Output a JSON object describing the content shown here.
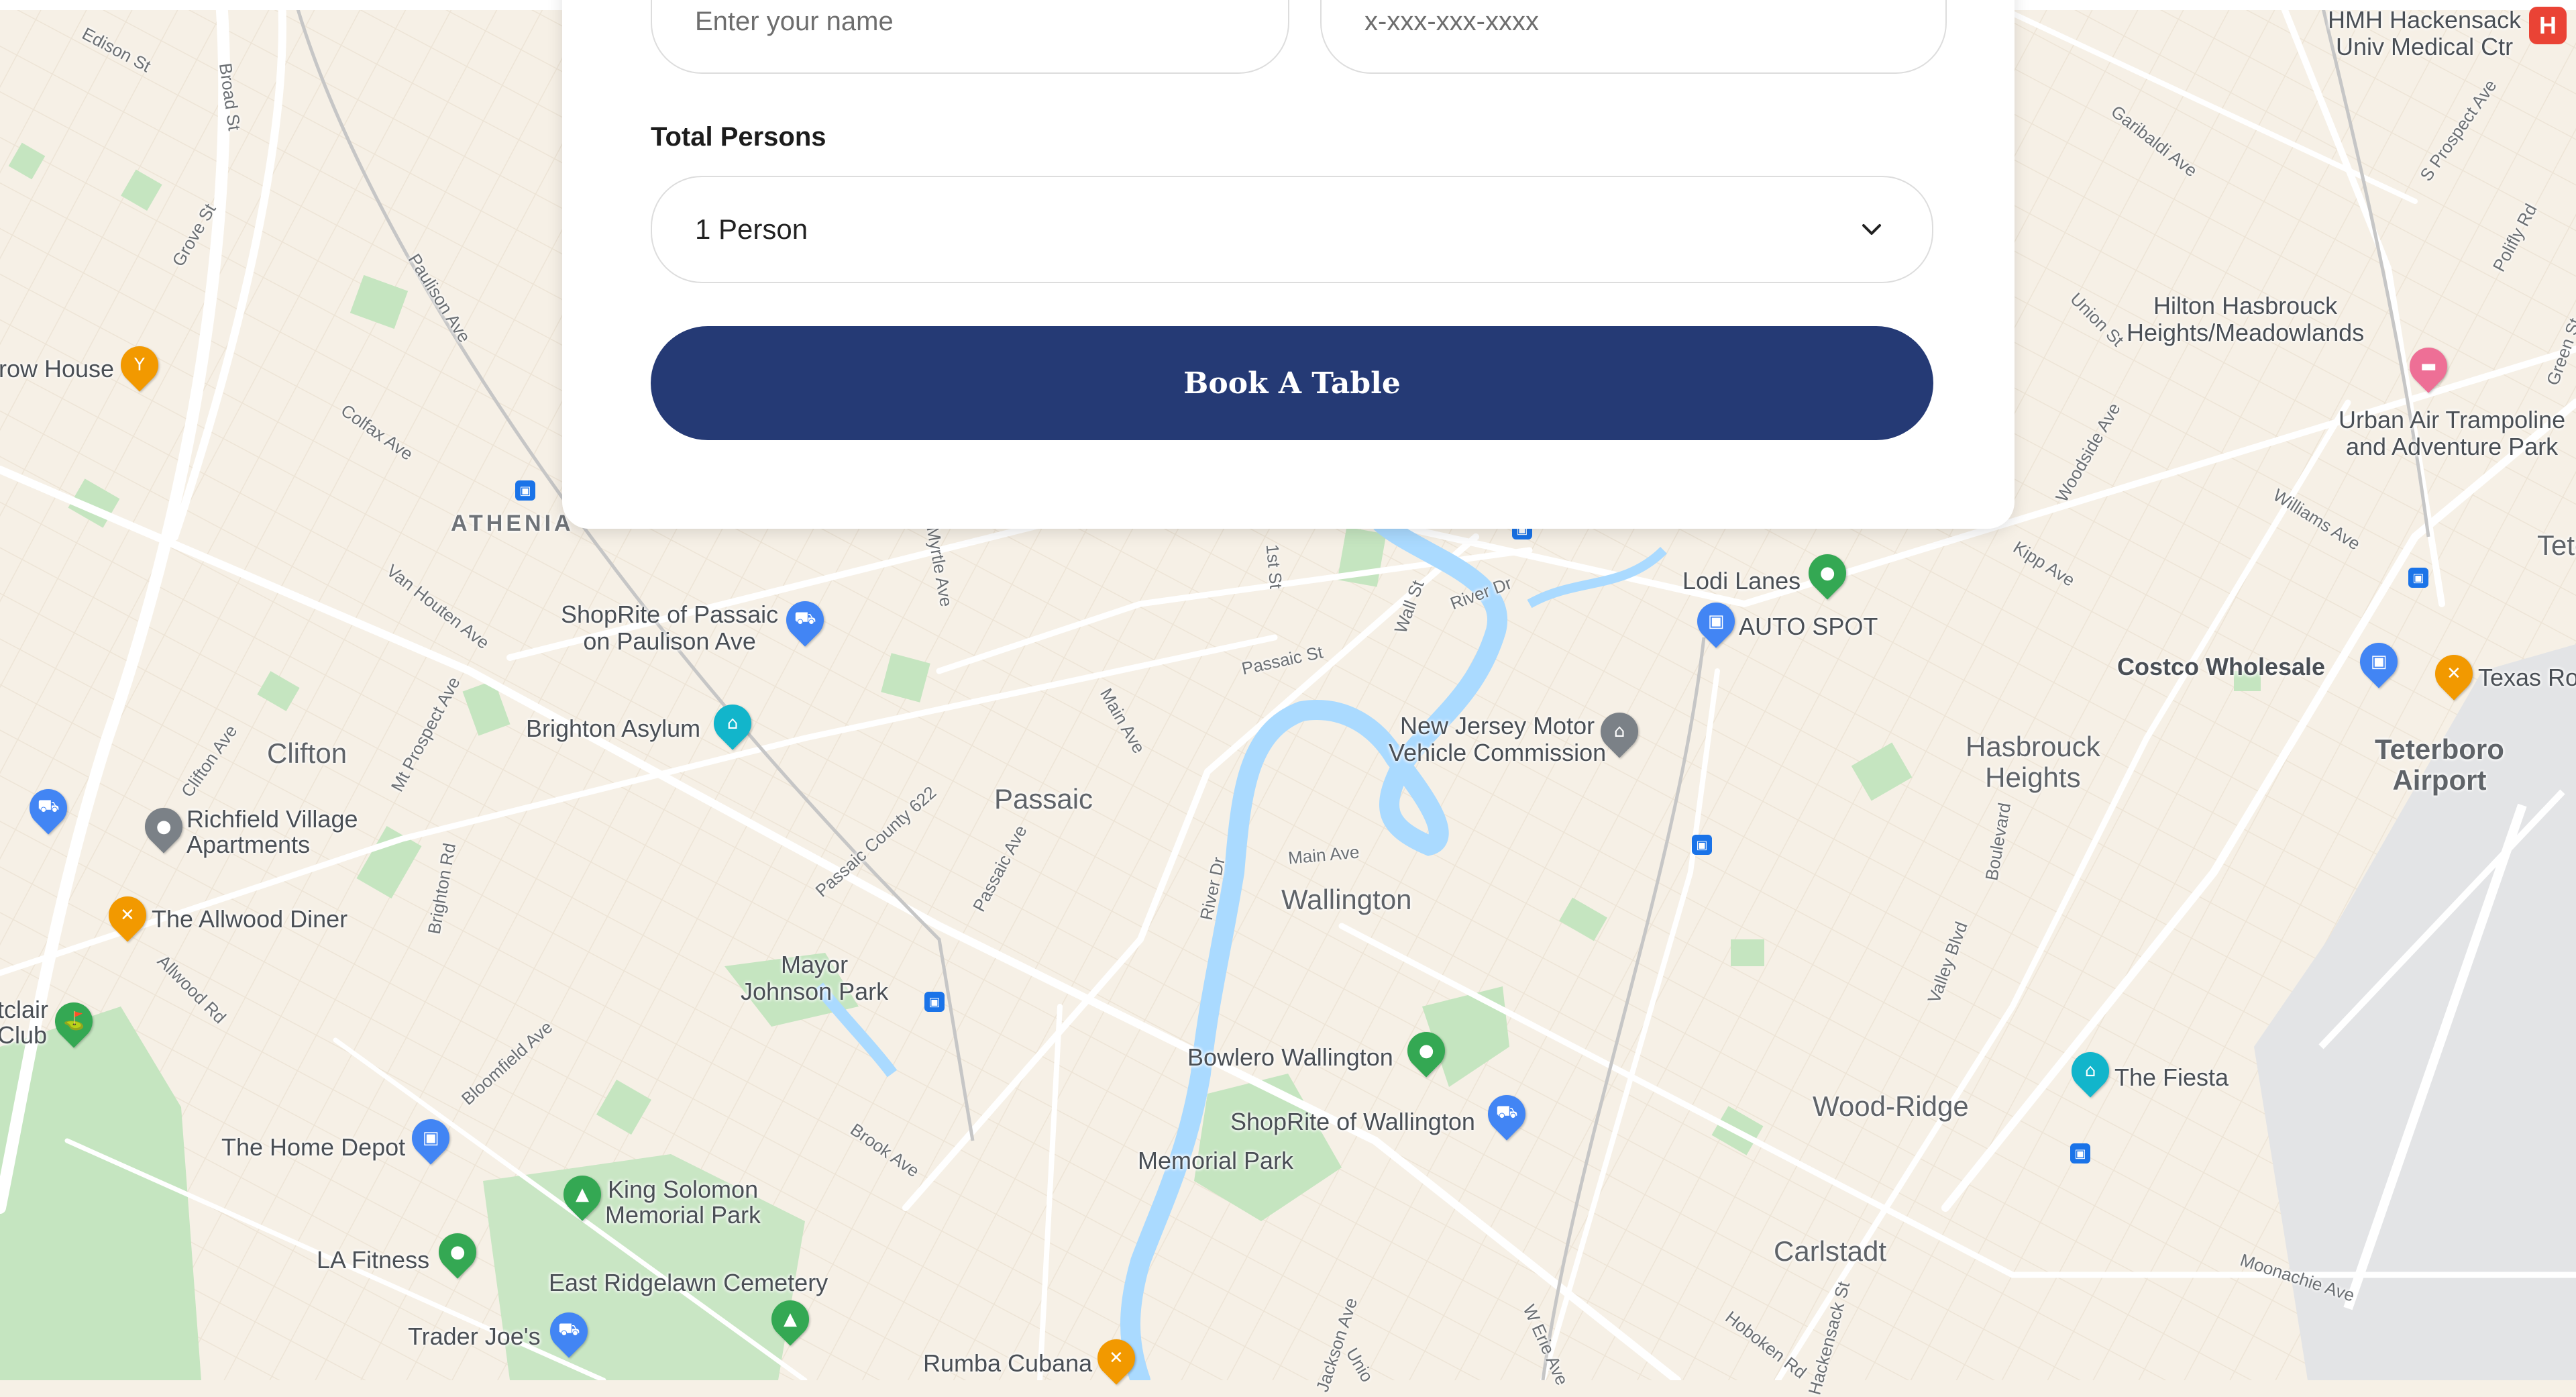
{
  "booking_form": {
    "name_placeholder": "Enter your name",
    "phone_placeholder": "x-xxx-xxx-xxxx",
    "total_persons_label": "Total Persons",
    "persons_selected": "1 Person",
    "book_button": "Book A Table"
  },
  "map": {
    "places": [
      {
        "name": "HMH Hackensack\nUniv Medical Ctr",
        "type": "hospital"
      },
      {
        "name": "Hilton Hasbrouck\nHeights/Meadowlands",
        "type": "hotel"
      },
      {
        "name": "Urban Air Trampoline\nand Adventure Park",
        "type": "attraction"
      },
      {
        "name": "row House",
        "type": "bar"
      },
      {
        "name": "ShopRite of Passaic\non Paulison Ave",
        "type": "shopping"
      },
      {
        "name": "Lodi Lanes",
        "type": "recreation"
      },
      {
        "name": "AUTO SPOT",
        "type": "shopping"
      },
      {
        "name": "Costco Wholesale",
        "type": "shopping"
      },
      {
        "name": "Texas Ro",
        "type": "restaurant"
      },
      {
        "name": "Brighton Asylum",
        "type": "attraction"
      },
      {
        "name": "New Jersey Motor\nVehicle Commission",
        "type": "government"
      },
      {
        "name": "Richfield Village\nApartments",
        "type": "residential"
      },
      {
        "name": "The Allwood Diner",
        "type": "restaurant"
      },
      {
        "name": "tclair\nClub",
        "type": "golf"
      },
      {
        "name": "Mayor\nJohnson Park",
        "type": "park"
      },
      {
        "name": "Bowlero Wallington",
        "type": "recreation"
      },
      {
        "name": "ShopRite of Wallington",
        "type": "shopping"
      },
      {
        "name": "The Fiesta",
        "type": "attraction"
      },
      {
        "name": "Memorial Park",
        "type": "park"
      },
      {
        "name": "The Home Depot",
        "type": "shopping"
      },
      {
        "name": "King Solomon\nMemorial Park",
        "type": "cemetery"
      },
      {
        "name": "LA Fitness",
        "type": "gym"
      },
      {
        "name": "East Ridgelawn Cemetery",
        "type": "cemetery"
      },
      {
        "name": "Trader Joe's",
        "type": "shopping"
      },
      {
        "name": "Rumba Cubana",
        "type": "restaurant"
      }
    ],
    "cities": [
      "Clifton",
      "Passaic",
      "Wallington",
      "Hasbrouck\nHeights",
      "Teterboro\nAirport",
      "Wood-Ridge",
      "Carlstadt",
      "Tete"
    ],
    "districts": [
      "ATHENIA"
    ],
    "streets": [
      "Edison St",
      "Broad St",
      "Grove St",
      "Paulison Ave",
      "Colfax Ave",
      "Van Houten Ave",
      "Mt Prospect Ave",
      "Clifton Ave",
      "Brighton Rd",
      "Allwood Rd",
      "Bloomfield Ave",
      "Passaic County 622",
      "Passaic Ave",
      "Myrtle Ave",
      "Main Ave",
      "1st St",
      "Passaic St",
      "Wall St",
      "River Dr",
      "Main Ave",
      "River Dr",
      "Brook Ave",
      "Jackson Ave",
      "W Erie Ave",
      "Hoboken Rd",
      "Hackensack St",
      "Valley Blvd",
      "Boulevard",
      "Woodside Ave",
      "Kipp Ave",
      "Williams Ave",
      "Union St",
      "Garibaldi Ave",
      "S Prospect Ave",
      "Polifly Rd",
      "Green St",
      "Moonachie Ave",
      "Unio",
      "Paulison Ave"
    ]
  },
  "colors": {
    "button": "#253a75",
    "map_background": "#f6f0e6",
    "water": "#aadaff",
    "park": "#c5e5c0",
    "road": "#ffffff"
  }
}
